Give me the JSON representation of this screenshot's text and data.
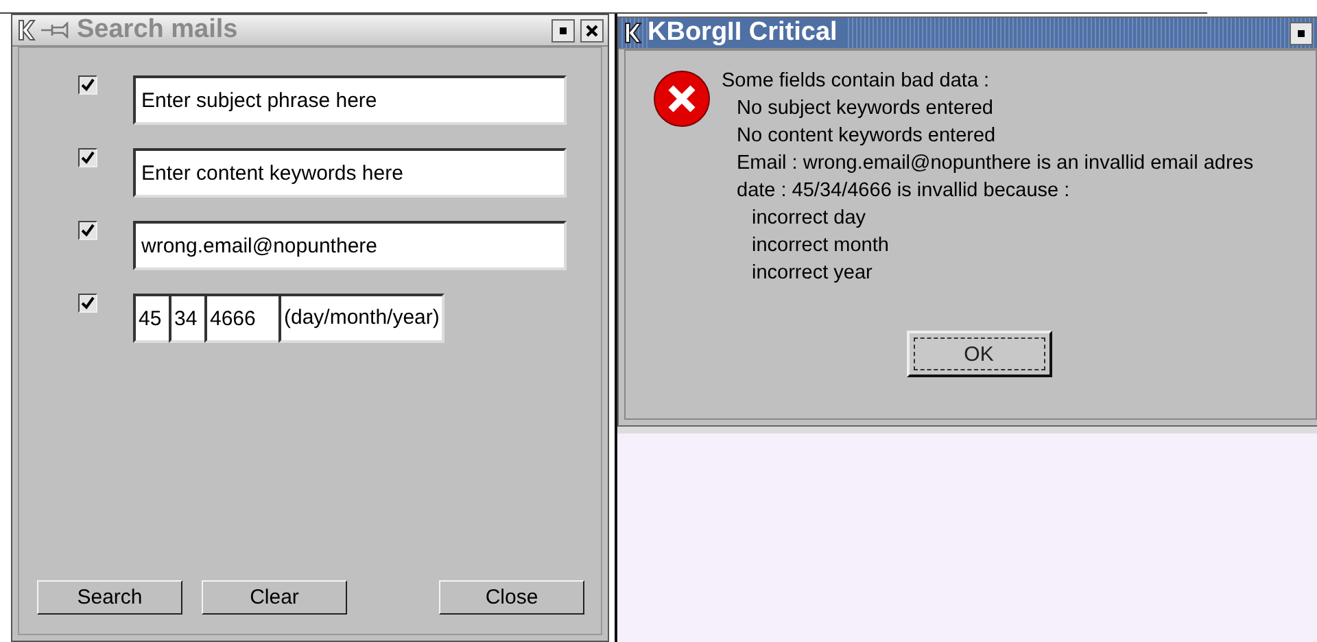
{
  "search_window": {
    "title": "Search mails",
    "criteria": [
      {
        "kind": "text",
        "checked": true,
        "value": "Enter subject phrase here"
      },
      {
        "kind": "text",
        "checked": true,
        "value": "Enter content keywords here"
      },
      {
        "kind": "text",
        "checked": true,
        "value": "wrong.email@nopunthere"
      },
      {
        "kind": "date",
        "checked": true,
        "day": "45",
        "month": "34",
        "year": "4666",
        "hint": "(day/month/year)"
      }
    ],
    "buttons": [
      "Search",
      "Clear",
      "Close"
    ]
  },
  "error_dialog": {
    "title": "KBorgII Critical",
    "message": {
      "text": "Some fields contain bad data :",
      "children": [
        {
          "text": "No subject keywords entered"
        },
        {
          "text": "No content keywords entered"
        },
        {
          "text": "Email : wrong.email@nopunthere is an invallid email adres"
        },
        {
          "text": "date : 45/34/4666 is invallid because :",
          "children": [
            {
              "text": "incorrect day"
            },
            {
              "text": "incorrect month"
            },
            {
              "text": "incorrect year"
            }
          ]
        }
      ]
    },
    "button": "OK"
  }
}
